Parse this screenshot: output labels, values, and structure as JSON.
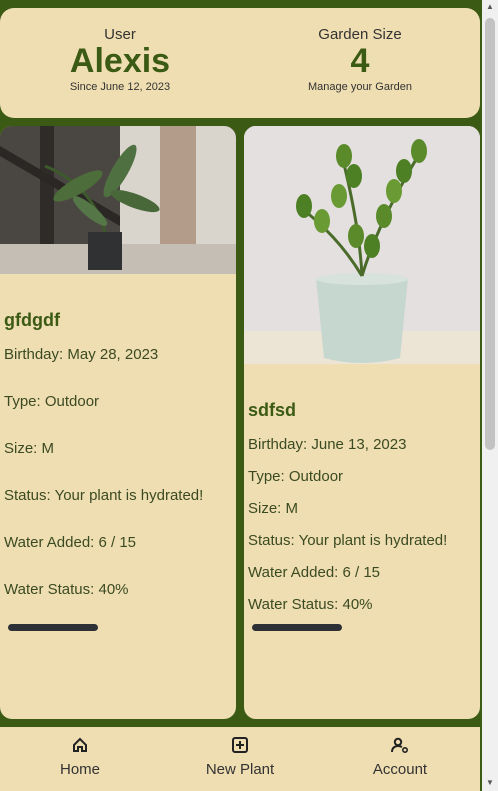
{
  "header": {
    "user_label": "User",
    "user_name": "Alexis",
    "since": "Since June 12, 2023",
    "garden_label": "Garden Size",
    "garden_size": "4",
    "manage": "Manage your Garden"
  },
  "plants": [
    {
      "name": "gfdgdf",
      "birthday": "Birthday: May 28, 2023",
      "type": "Type: Outdoor",
      "size": "Size: M",
      "status": "Status: Your plant is hydrated!",
      "water_added": "Water Added: 6 / 15",
      "water_status": "Water Status: 40%",
      "water_level": 0.4,
      "image": "plant-photo-bird-of-paradise"
    },
    {
      "name": "sdfsd",
      "birthday": "Birthday: June 13, 2023",
      "type": "Type: Outdoor",
      "size": "Size: M",
      "status": "Status: Your plant is hydrated!",
      "water_added": "Water Added: 6 / 15",
      "water_status": "Water Status: 40%",
      "water_level": 0.4,
      "image": "plant-photo-zz-plant"
    }
  ],
  "nav": {
    "home": "Home",
    "new_plant": "New Plant",
    "account": "Account",
    "home_icon": "home-icon",
    "add_icon": "plus-square-icon",
    "account_icon": "user-gear-icon"
  },
  "colors": {
    "brand": "#3b5a14",
    "card": "#efdeb2",
    "bar": "#2d3035"
  }
}
